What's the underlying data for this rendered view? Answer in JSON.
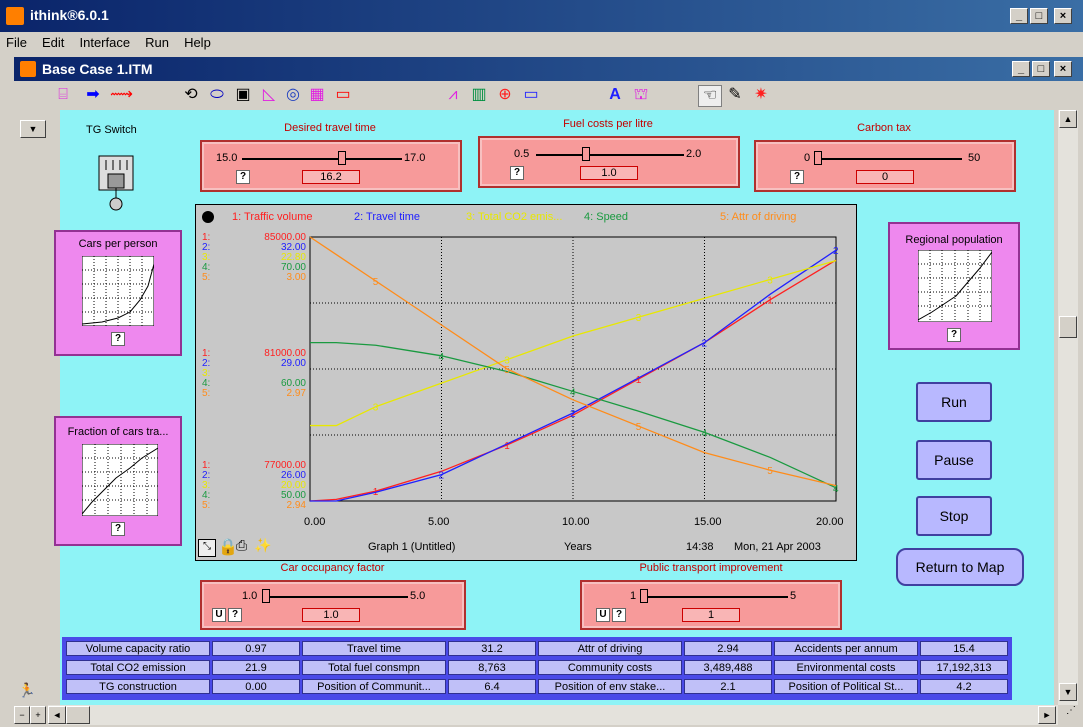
{
  "app": {
    "title": "ithink®6.0.1"
  },
  "menu": {
    "items": [
      "File",
      "Edit",
      "Interface",
      "Run",
      "Help"
    ]
  },
  "document": {
    "title": "Base Case 1.ITM"
  },
  "tg_switch": {
    "label": "TG Switch"
  },
  "sliders": {
    "desired_travel_time": {
      "title": "Desired travel time",
      "min": "15.0",
      "max": "17.0",
      "value": "16.2",
      "level": 0.6
    },
    "fuel_costs": {
      "title": "Fuel costs per litre",
      "min": "0.5",
      "max": "2.0",
      "value": "1.0",
      "level": 0.33
    },
    "carbon_tax": {
      "title": "Carbon tax",
      "min": "0",
      "max": "50",
      "value": "0",
      "level": 0.0
    },
    "car_occupancy": {
      "title": "Car occupancy factor",
      "min": "1.0",
      "max": "5.0",
      "value": "1.0",
      "level": 0.0
    },
    "public_transport": {
      "title": "Public transport improvement",
      "min": "1",
      "max": "5",
      "value": "1",
      "level": 0.0
    }
  },
  "help_btn": "?",
  "u_btn": "U",
  "graphical_functions": {
    "cars_per_person": "Cars per person",
    "fraction_cars": "Fraction of cars tra...",
    "regional_population": "Regional population"
  },
  "buttons": {
    "run": "Run",
    "pause": "Pause",
    "stop": "Stop",
    "return_to_map": "Return to Map"
  },
  "graph": {
    "legend": [
      "1: Traffic volume",
      "2: Travel time",
      "3: Total CO2 emis...",
      "4: Speed",
      "5: Attr of driving"
    ],
    "scale_top": [
      "1:",
      "85000.00",
      "2:",
      "32.00",
      "3:",
      "22.80",
      "4:",
      "70.00",
      "5:",
      "3.00"
    ],
    "scale_mid": [
      "1:",
      "81000.00",
      "2:",
      "29.00",
      "3:",
      "",
      "4:",
      "60.00",
      "5:",
      "2.97"
    ],
    "scale_bot": [
      "1:",
      "77000.00",
      "2:",
      "26.00",
      "3:",
      "20.00",
      "4:",
      "50.00",
      "5:",
      "2.94"
    ],
    "x_ticks": [
      "0.00",
      "5.00",
      "10.00",
      "15.00",
      "20.00"
    ],
    "footer_name": "Graph 1 (Untitled)",
    "footer_unit": "Years",
    "footer_time": "14:38",
    "footer_date": "Mon, 21 Apr 2003"
  },
  "chart_data": {
    "type": "line",
    "title": "",
    "xlabel": "Years",
    "x": [
      0,
      1,
      2.5,
      5,
      7.5,
      10,
      12.5,
      15,
      17.5,
      20
    ],
    "xlim": [
      0,
      20
    ],
    "series": [
      {
        "name": "1: Traffic volume",
        "color": "#ff2020",
        "ylim": [
          77000,
          85000
        ],
        "values": [
          77000,
          77050,
          77300,
          77900,
          78700,
          79600,
          80700,
          81800,
          83100,
          84300
        ]
      },
      {
        "name": "2: Travel time",
        "color": "#2020ff",
        "ylim": [
          26,
          32
        ],
        "values": [
          26.0,
          26.0,
          26.2,
          26.6,
          27.3,
          28.0,
          28.8,
          29.6,
          30.7,
          31.7
        ]
      },
      {
        "name": "3: Total CO2 emis...",
        "color": "#e8e800",
        "ylim": [
          20.0,
          22.8
        ],
        "values": [
          20.8,
          20.8,
          21.0,
          21.25,
          21.5,
          21.75,
          21.95,
          22.15,
          22.35,
          22.55
        ]
      },
      {
        "name": "4: Speed",
        "color": "#1a9a40",
        "ylim": [
          50,
          70
        ],
        "values": [
          62.0,
          62.0,
          61.8,
          61.0,
          59.8,
          58.3,
          56.8,
          55.2,
          53.3,
          51.0
        ]
      },
      {
        "name": "5: Attr of driving",
        "color": "#ff8c1a",
        "ylim": [
          2.94,
          3.0
        ],
        "values": [
          3.0,
          2.996,
          2.99,
          2.98,
          2.97,
          2.963,
          2.957,
          2.951,
          2.947,
          2.9435
        ]
      }
    ]
  },
  "table": [
    [
      [
        "Volume capacity ratio",
        "0.97"
      ],
      [
        "Travel time",
        "31.2"
      ],
      [
        "Attr of driving",
        "2.94"
      ],
      [
        "Accidents per annum",
        "15.4"
      ]
    ],
    [
      [
        "Total CO2 emission",
        "21.9"
      ],
      [
        "Total fuel consmpn",
        "8,763"
      ],
      [
        "Community costs",
        "3,489,488"
      ],
      [
        "Environmental costs",
        "17,192,313"
      ]
    ],
    [
      [
        "TG construction",
        "0.00"
      ],
      [
        "Position of Communit...",
        "6.4"
      ],
      [
        "Position of env stake...",
        "2.1"
      ],
      [
        "Position of Political St...",
        "4.2"
      ]
    ]
  ],
  "scroll": {
    "left_arrow": "◄",
    "right_arrow": "►",
    "up_arrow": "▲",
    "down_arrow": "▼",
    "minus": "−",
    "plus": "+"
  }
}
